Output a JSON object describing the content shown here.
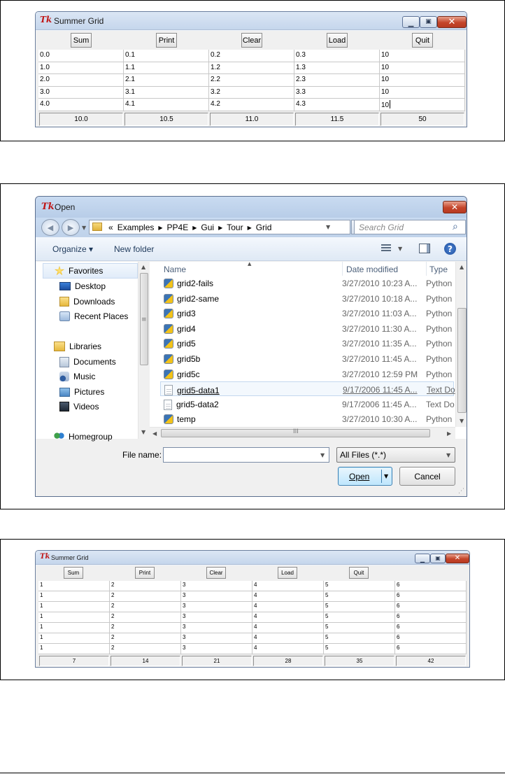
{
  "windows": [
    {
      "title": "Summer Grid",
      "buttons": [
        "Sum",
        "Print",
        "Clear",
        "Load",
        "Quit"
      ],
      "rows": [
        [
          "0.0",
          "0.1",
          "0.2",
          "0.3",
          "10"
        ],
        [
          "1.0",
          "1.1",
          "1.2",
          "1.3",
          "10"
        ],
        [
          "2.0",
          "2.1",
          "2.2",
          "2.3",
          "10"
        ],
        [
          "3.0",
          "3.1",
          "3.2",
          "3.3",
          "10"
        ],
        [
          "4.0",
          "4.1",
          "4.2",
          "4.3",
          "10"
        ]
      ],
      "sums": [
        "10.0",
        "10.5",
        "11.0",
        "11.5",
        "50"
      ]
    },
    {
      "title": "Summer Grid",
      "buttons": [
        "Sum",
        "Print",
        "Clear",
        "Load",
        "Quit"
      ],
      "rows": [
        [
          "1",
          "2",
          "3",
          "4",
          "5",
          "6"
        ],
        [
          "1",
          "2",
          "3",
          "4",
          "5",
          "6"
        ],
        [
          "1",
          "2",
          "3",
          "4",
          "5",
          "6"
        ],
        [
          "1",
          "2",
          "3",
          "4",
          "5",
          "6"
        ],
        [
          "1",
          "2",
          "3",
          "4",
          "5",
          "6"
        ],
        [
          "1",
          "2",
          "3",
          "4",
          "5",
          "6"
        ],
        [
          "1",
          "2",
          "3",
          "4",
          "5",
          "6"
        ]
      ],
      "sums": [
        "7",
        "14",
        "21",
        "28",
        "35",
        "42"
      ]
    }
  ],
  "open_dialog": {
    "title": "Open",
    "path": [
      "«",
      "Examples",
      "PP4E",
      "Gui",
      "Tour",
      "Grid"
    ],
    "search_placeholder": "Search Grid",
    "organize": "Organize ▾",
    "new_folder": "New folder",
    "nav": [
      {
        "label": "Favorites",
        "icon": "star-icon",
        "kind": "group"
      },
      {
        "label": "Desktop",
        "icon": "desktop-icon",
        "kind": "item"
      },
      {
        "label": "Downloads",
        "icon": "downloads-icon",
        "kind": "item"
      },
      {
        "label": "Recent Places",
        "icon": "recent-places-icon",
        "kind": "item"
      },
      {
        "label": "Libraries",
        "icon": "libraries-icon",
        "kind": "group"
      },
      {
        "label": "Documents",
        "icon": "documents-icon",
        "kind": "item"
      },
      {
        "label": "Music",
        "icon": "music-icon",
        "kind": "item"
      },
      {
        "label": "Pictures",
        "icon": "pictures-icon",
        "kind": "item"
      },
      {
        "label": "Videos",
        "icon": "videos-icon",
        "kind": "item"
      },
      {
        "label": "Homegroup",
        "icon": "homegroup-icon",
        "kind": "group"
      }
    ],
    "columns": {
      "name": "Name",
      "date": "Date modified",
      "type": "Type"
    },
    "files": [
      {
        "name": "grid2-fails",
        "date": "3/27/2010 10:23 A...",
        "type": "Python",
        "icon": "python-file-icon"
      },
      {
        "name": "grid2-same",
        "date": "3/27/2010 10:18 A...",
        "type": "Python",
        "icon": "python-file-icon"
      },
      {
        "name": "grid3",
        "date": "3/27/2010 11:03 A...",
        "type": "Python",
        "icon": "python-file-icon"
      },
      {
        "name": "grid4",
        "date": "3/27/2010 11:30 A...",
        "type": "Python",
        "icon": "python-file-icon"
      },
      {
        "name": "grid5",
        "date": "3/27/2010 11:35 A...",
        "type": "Python",
        "icon": "python-file-icon"
      },
      {
        "name": "grid5b",
        "date": "3/27/2010 11:45 A...",
        "type": "Python",
        "icon": "python-file-icon"
      },
      {
        "name": "grid5c",
        "date": "3/27/2010 12:59 PM",
        "type": "Python",
        "icon": "python-file-icon"
      },
      {
        "name": "grid5-data1",
        "date": "9/17/2006 11:45 A...",
        "type": "Text Do",
        "icon": "text-file-icon",
        "selected": true
      },
      {
        "name": "grid5-data2",
        "date": "9/17/2006 11:45 A...",
        "type": "Text Do",
        "icon": "text-file-icon"
      },
      {
        "name": "temp",
        "date": "3/27/2010 10:30 A...",
        "type": "Python",
        "icon": "python-file-icon"
      }
    ],
    "file_name_label": "File name:",
    "file_name_value": "",
    "filter": "All Files (*.*)",
    "open_label": "Open",
    "cancel_label": "Cancel"
  }
}
